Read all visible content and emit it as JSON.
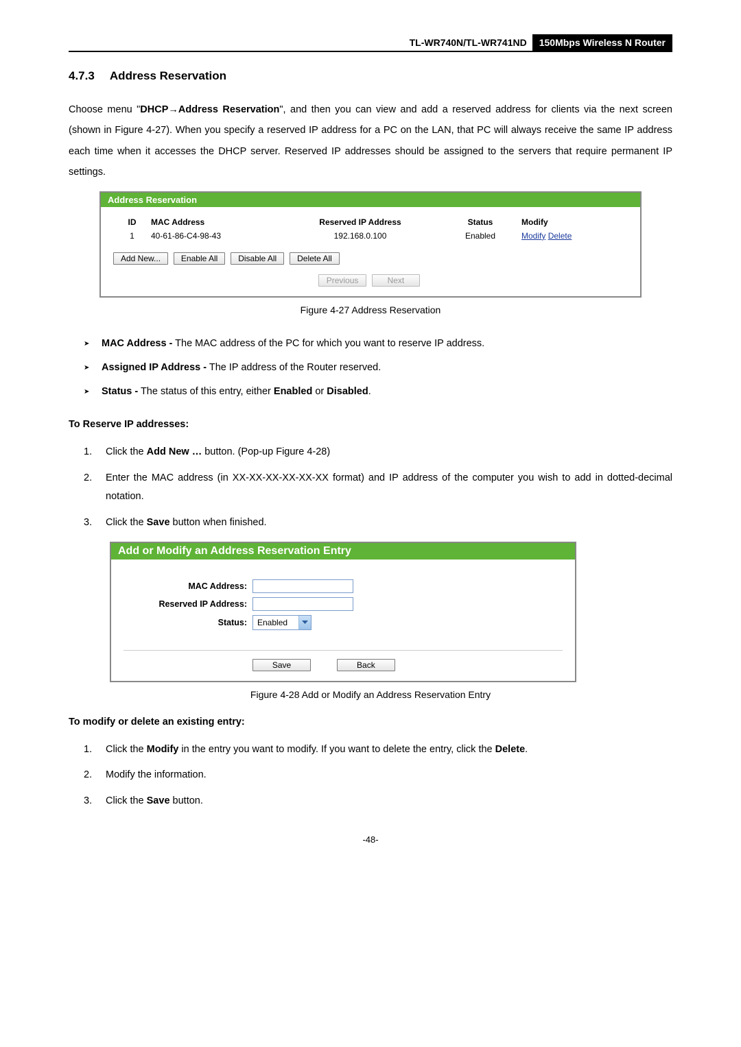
{
  "header": {
    "model": "TL-WR740N/TL-WR741ND",
    "product": "150Mbps Wireless N Router"
  },
  "section": {
    "number": "4.7.3",
    "title": "Address Reservation"
  },
  "intro": {
    "pre": "Choose menu \"",
    "menu1": "DHCP",
    "arrow": "→",
    "menu2": "Address Reservation",
    "post": "\", and then you can view and add a reserved address for clients via the next screen (shown in Figure 4-27). When you specify a reserved IP address for a PC on the LAN, that PC will always receive the same IP address each time when it accesses the DHCP server. Reserved IP addresses should be assigned to the servers that require permanent IP settings."
  },
  "fig1": {
    "title": "Address Reservation",
    "headers": {
      "id": "ID",
      "mac": "MAC Address",
      "ip": "Reserved IP Address",
      "status": "Status",
      "mod": "Modify"
    },
    "row": {
      "id": "1",
      "mac": "40-61-86-C4-98-43",
      "ip": "192.168.0.100",
      "status": "Enabled",
      "modify": "Modify",
      "delete": "Delete"
    },
    "buttons": {
      "addnew": "Add New...",
      "enableall": "Enable All",
      "disableall": "Disable All",
      "deleteall": "Delete All",
      "prev": "Previous",
      "next": "Next"
    },
    "caption": "Figure 4-27    Address Reservation"
  },
  "bullets": {
    "b1t": "MAC Address -",
    "b1d": " The MAC address of the PC for which you want to reserve IP address.",
    "b2t": "Assigned IP Address -",
    "b2d": " The IP address of the Router reserved.",
    "b3t": "Status -",
    "b3d_a": " The status of this entry, either ",
    "b3d_en": "Enabled",
    "b3d_b": " or ",
    "b3d_dis": "Disabled",
    "b3d_c": "."
  },
  "reserve_head": "To Reserve IP addresses:",
  "reserve_steps": {
    "s1_a": "Click the ",
    "s1_b": "Add New …",
    "s1_c": " button. (Pop-up Figure 4-28)",
    "s2": "Enter the MAC address (in XX-XX-XX-XX-XX-XX format) and IP address of the computer you wish to add in dotted-decimal notation.",
    "s3_a": "Click the ",
    "s3_b": "Save",
    "s3_c": " button when finished."
  },
  "fig2": {
    "title": "Add or Modify an Address Reservation Entry",
    "labels": {
      "mac": "MAC Address:",
      "ip": "Reserved IP Address:",
      "status": "Status:"
    },
    "status_value": "Enabled",
    "buttons": {
      "save": "Save",
      "back": "Back"
    },
    "caption": "Figure 4-28    Add or Modify an Address Reservation Entry"
  },
  "modify_head": "To modify or delete an existing entry:",
  "modify_steps": {
    "s1_a": "Click the ",
    "s1_b": "Modify",
    "s1_c": " in the entry you want to modify. If you want to delete the entry, click the ",
    "s1_d": "Delete",
    "s1_e": ".",
    "s2": "Modify the information.",
    "s3_a": "Click the ",
    "s3_b": "Save",
    "s3_c": " button."
  },
  "page_number": "-48-"
}
